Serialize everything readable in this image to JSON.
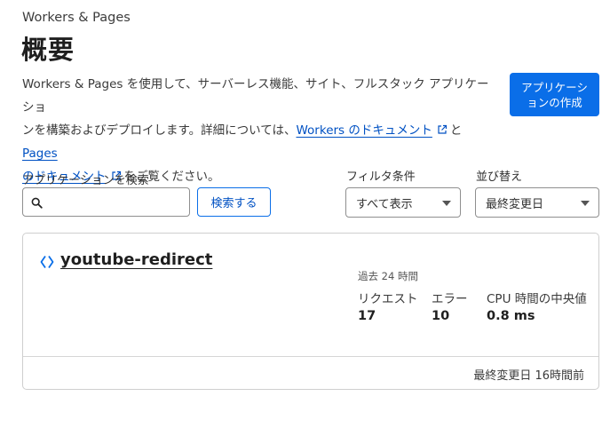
{
  "header": {
    "breadcrumb": "Workers & Pages",
    "title": "概要"
  },
  "description": {
    "line1": "Workers & Pages を使用して、サーバーレス機能、サイト、フルスタック アプリケーショ",
    "line2_prefix": "ンを構築およびデプロイします。詳細については、",
    "workers_docs_link": "Workers のドキュメント",
    "connector": "と",
    "pages_docs_link_part1": "Pages",
    "pages_docs_link_part2": "のドキュメント",
    "suffix": "をご覧ください。"
  },
  "create_button": "アプリケーションの作成",
  "search": {
    "label": "アプリケーションを検索",
    "value": "",
    "button": "検索する"
  },
  "filter": {
    "label": "フィルタ条件",
    "selected": "すべて表示"
  },
  "sort": {
    "label": "並び替え",
    "selected": "最終変更日"
  },
  "workers": [
    {
      "name": "youtube-redirect",
      "metrics_period": "過去 24 時間",
      "metrics": [
        {
          "label": "リクエスト",
          "value": "17"
        },
        {
          "label": "エラー",
          "value": "10"
        },
        {
          "label": "CPU 時間の中央値",
          "value": "0.8 ms"
        }
      ],
      "last_modified": "最終変更日 16時間前"
    }
  ],
  "colors": {
    "accent": "#0a6ee8",
    "link": "#0051c3"
  }
}
